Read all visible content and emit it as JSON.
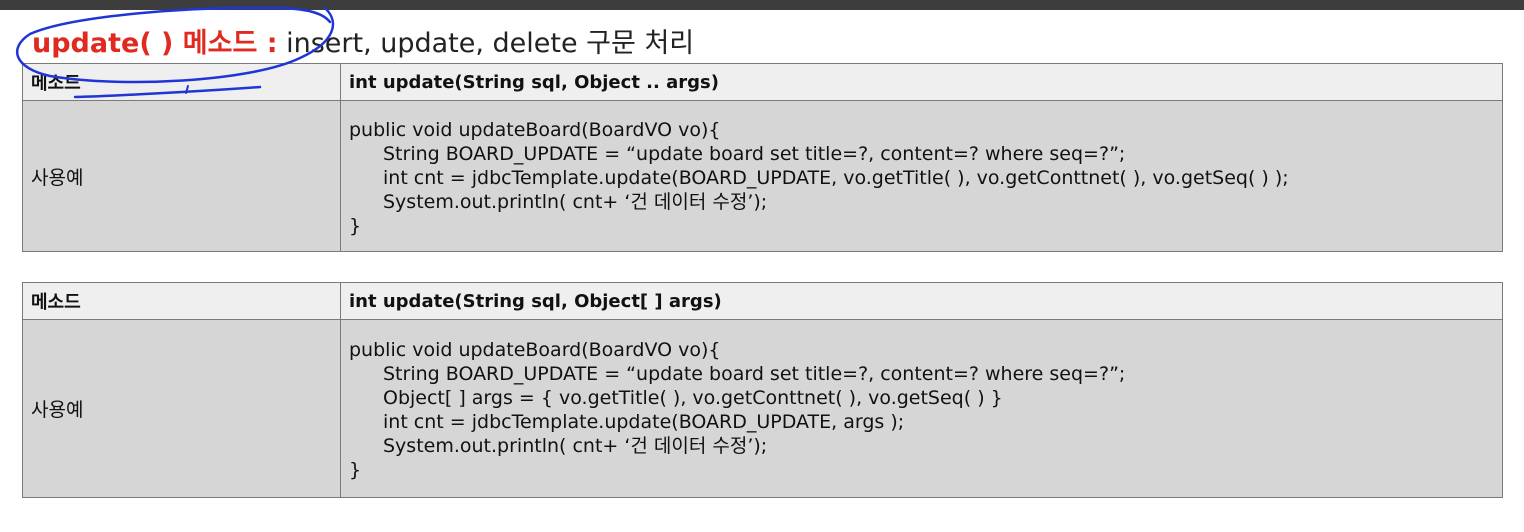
{
  "heading": {
    "keyword": "update( ) 메소드 :",
    "rest": " insert, update, delete 구문 처리"
  },
  "tables": [
    {
      "method_label": "메소드",
      "signature": "int update(String sql, Object .. args)",
      "example_label": "사용예",
      "code": [
        "public void updateBoard(BoardVO vo){",
        "String BOARD_UPDATE = “update board set title=?, content=? where seq=?”;",
        "int cnt = jdbcTemplate.update(BOARD_UPDATE, vo.getTitle( ), vo.getConttnet( ), vo.getSeq( ) );",
        "System.out.println( cnt+ ‘건 데이터 수정’);",
        "}"
      ]
    },
    {
      "method_label": "메소드",
      "signature": "int update(String sql, Object[ ] args)",
      "example_label": "사용예",
      "code": [
        "public void updateBoard(BoardVO vo){",
        "String BOARD_UPDATE = “update board set title=?, content=? where seq=?”;",
        "Object[ ] args = { vo.getTitle( ), vo.getConttnet( ), vo.getSeq( ) }",
        "int cnt = jdbcTemplate.update(BOARD_UPDATE, args );",
        "System.out.println( cnt+ ‘건 데이터 수정’);",
        "}"
      ]
    }
  ],
  "annotation_color": "#1f35d6",
  "keyword_color": "#e02a1f"
}
